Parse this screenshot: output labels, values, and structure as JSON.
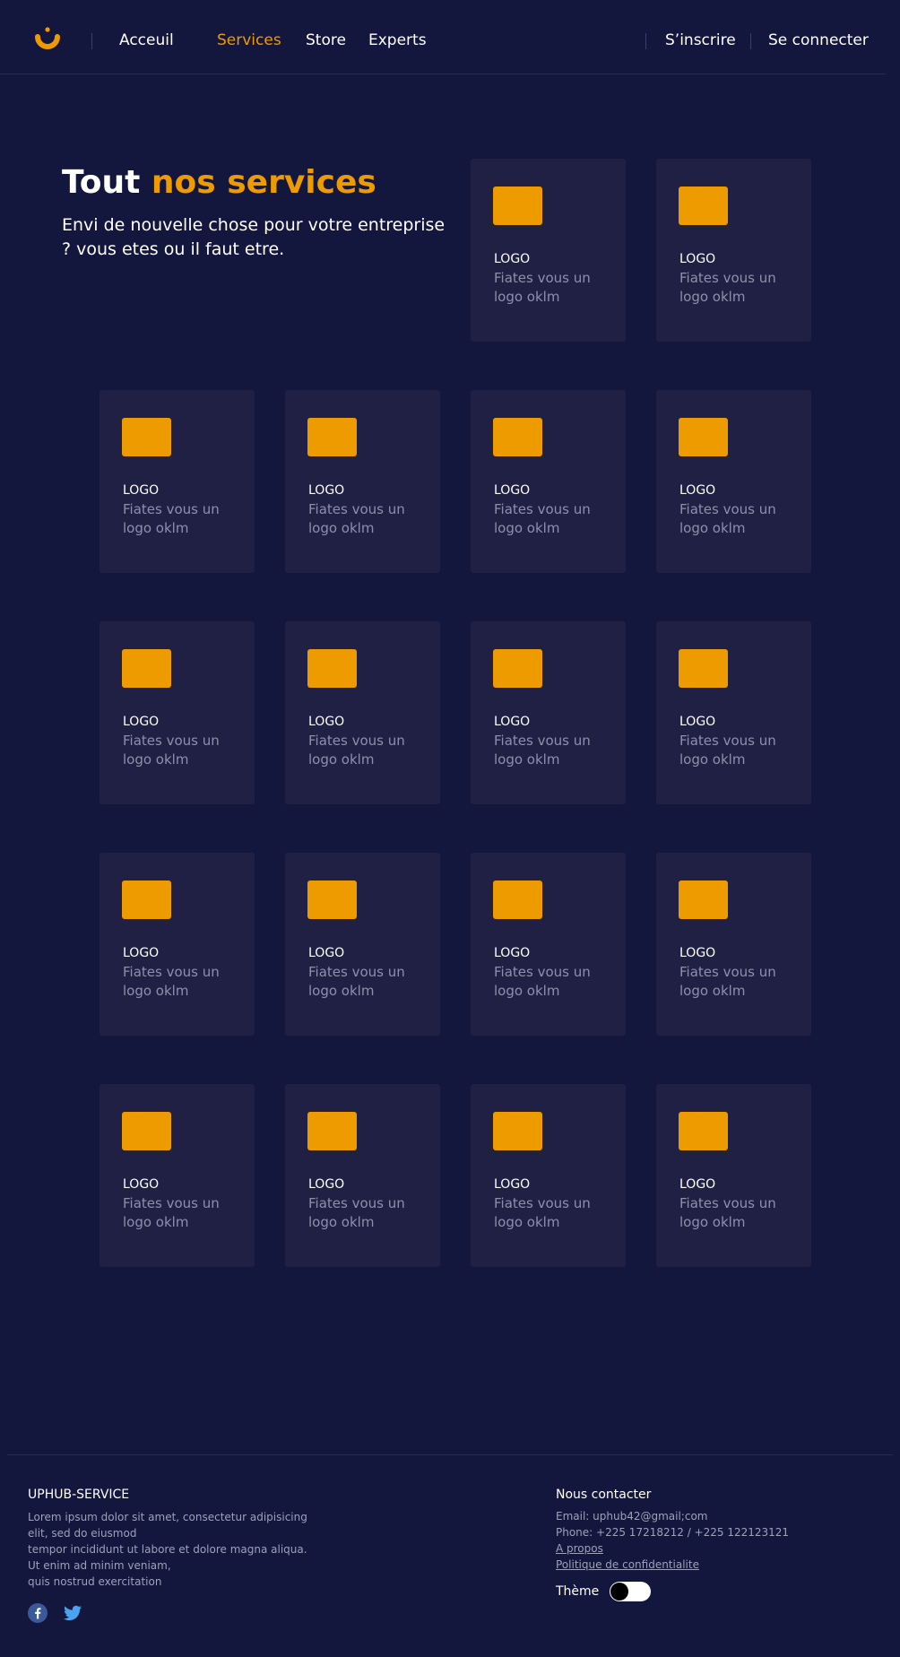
{
  "nav": {
    "links": [
      {
        "label": "Acceuil",
        "active": false
      },
      {
        "label": "Services",
        "active": true
      },
      {
        "label": "Store",
        "active": false
      },
      {
        "label": "Experts",
        "active": false
      }
    ],
    "signup": "S’inscrire",
    "login": "Se connecter",
    "logo_icon": "uphub-logo-icon"
  },
  "hero": {
    "title_part1": "Tout",
    "title_part2": "nos services",
    "subtitle": "Envi de nouvelle chose pour votre entreprise ? vous etes ou il faut etre."
  },
  "cards": [
    {
      "title": "LOGO",
      "desc": "Fiates vous un logo oklm"
    },
    {
      "title": "LOGO",
      "desc": "Fiates vous un logo oklm"
    },
    {
      "title": "LOGO",
      "desc": "Fiates vous un logo oklm"
    },
    {
      "title": "LOGO",
      "desc": "Fiates vous un logo oklm"
    },
    {
      "title": "LOGO",
      "desc": "Fiates vous un logo oklm"
    },
    {
      "title": "LOGO",
      "desc": "Fiates vous un logo oklm"
    },
    {
      "title": "LOGO",
      "desc": "Fiates vous un logo oklm"
    },
    {
      "title": "LOGO",
      "desc": "Fiates vous un logo oklm"
    },
    {
      "title": "LOGO",
      "desc": "Fiates vous un logo oklm"
    },
    {
      "title": "LOGO",
      "desc": "Fiates vous un logo oklm"
    },
    {
      "title": "LOGO",
      "desc": "Fiates vous un logo oklm"
    },
    {
      "title": "LOGO",
      "desc": "Fiates vous un logo oklm"
    },
    {
      "title": "LOGO",
      "desc": "Fiates vous un logo oklm"
    },
    {
      "title": "LOGO",
      "desc": "Fiates vous un logo oklm"
    },
    {
      "title": "LOGO",
      "desc": "Fiates vous un logo oklm"
    },
    {
      "title": "LOGO",
      "desc": "Fiates vous un logo oklm"
    },
    {
      "title": "LOGO",
      "desc": "Fiates vous un logo oklm"
    },
    {
      "title": "LOGO",
      "desc": "Fiates vous un logo oklm"
    }
  ],
  "footer": {
    "brand": "UPHUB-SERVICE",
    "description": [
      "Lorem ipsum dolor sit amet, consectetur adipisicing",
      "elit, sed do eiusmod",
      "tempor incididunt ut labore et dolore magna aliqua.",
      "Ut enim ad minim veniam,",
      "quis nostrud exercitation"
    ],
    "social_icons": [
      "facebook-icon",
      "twitter-icon"
    ],
    "contact_title": "Nous contacter",
    "email": "Email: uphub42@gmail;com",
    "phone": "Phone: +225 17218212 / +225 122123121",
    "about": "A propos",
    "privacy": "Politique de confidentialite",
    "theme_label": "Thème",
    "theme_toggle_on": false
  },
  "colors": {
    "background": "#13163d",
    "card": "#1f2043",
    "accent": "#ee9b00",
    "muted_text": "#8e90ab"
  }
}
